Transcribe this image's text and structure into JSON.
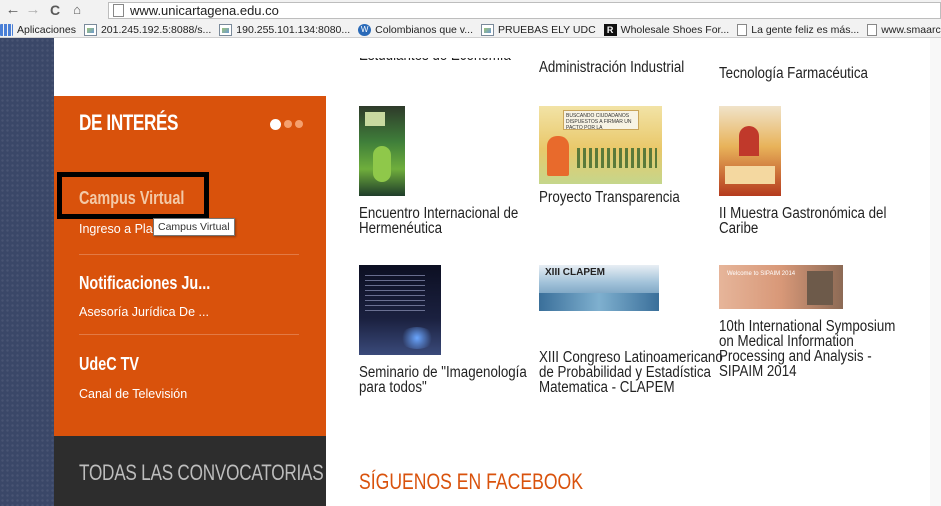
{
  "browser": {
    "url": "www.unicartagena.edu.co",
    "bookmarks": [
      {
        "label": "Aplicaciones",
        "icon": "apps-icon"
      },
      {
        "label": "201.245.192.5:8088/s...",
        "icon": "image-icon"
      },
      {
        "label": "190.255.101.134:8080...",
        "icon": "image-icon"
      },
      {
        "label": "Colombianos que v...",
        "icon": "wordpress-icon"
      },
      {
        "label": "PRUEBAS ELY UDC",
        "icon": "image-icon"
      },
      {
        "label": "Wholesale Shoes For...",
        "icon": "r-logo-icon"
      },
      {
        "label": "La gente feliz es más...",
        "icon": "page-icon"
      },
      {
        "label": "www.smaarc.edu.c",
        "icon": "page-icon"
      }
    ]
  },
  "sidebar": {
    "title": "DE INTERÉS",
    "items": [
      {
        "title": "Campus Virtual",
        "subtitle": "Ingreso a Pla"
      },
      {
        "title": "Notificaciones Ju...",
        "subtitle": "Asesoría Jurídica    De ..."
      },
      {
        "title": "UdeC TV",
        "subtitle": "Canal de Televisión"
      }
    ],
    "tooltip": "Campus Virtual",
    "all_calls": "TODAS LAS CONVOCATORIAS"
  },
  "content": {
    "top_row": [
      {
        "title": "Estudiantes de Economía"
      },
      {
        "title": "Administración Industrial"
      },
      {
        "title": "Tecnología Farmacéutica"
      }
    ],
    "row1": [
      {
        "title": "Encuentro Internacional de\nHermenéutica"
      },
      {
        "title": "Proyecto Transparencia"
      },
      {
        "title": "II Muestra Gastronómica del\nCaribe"
      }
    ],
    "row2": [
      {
        "title": "Seminario de \"Imagenología\npara todos\""
      },
      {
        "title": "XIII Congreso Latinoamericano\nde Probabilidad y Estadística\nMatematica - CLAPEM"
      },
      {
        "title": "10th International Symposium\non Medical Information\nProcessing and Analysis -\nSIPAIM 2014"
      }
    ],
    "thumb_text": {
      "transparencia": "BUSCANDO CIUDADANOS DISPUESTOS A FIRMAR UN PACTO POR LA TRANSPARENCIA",
      "clapem": "XIII CLAPEM",
      "sipaim": "Welcome to SIPAIM 2014"
    },
    "facebook_title": "SÍGUENOS EN FACEBOOK"
  },
  "colors": {
    "orange": "#d9520c",
    "dark": "#2d2d2d",
    "navy": "#3a4768"
  }
}
